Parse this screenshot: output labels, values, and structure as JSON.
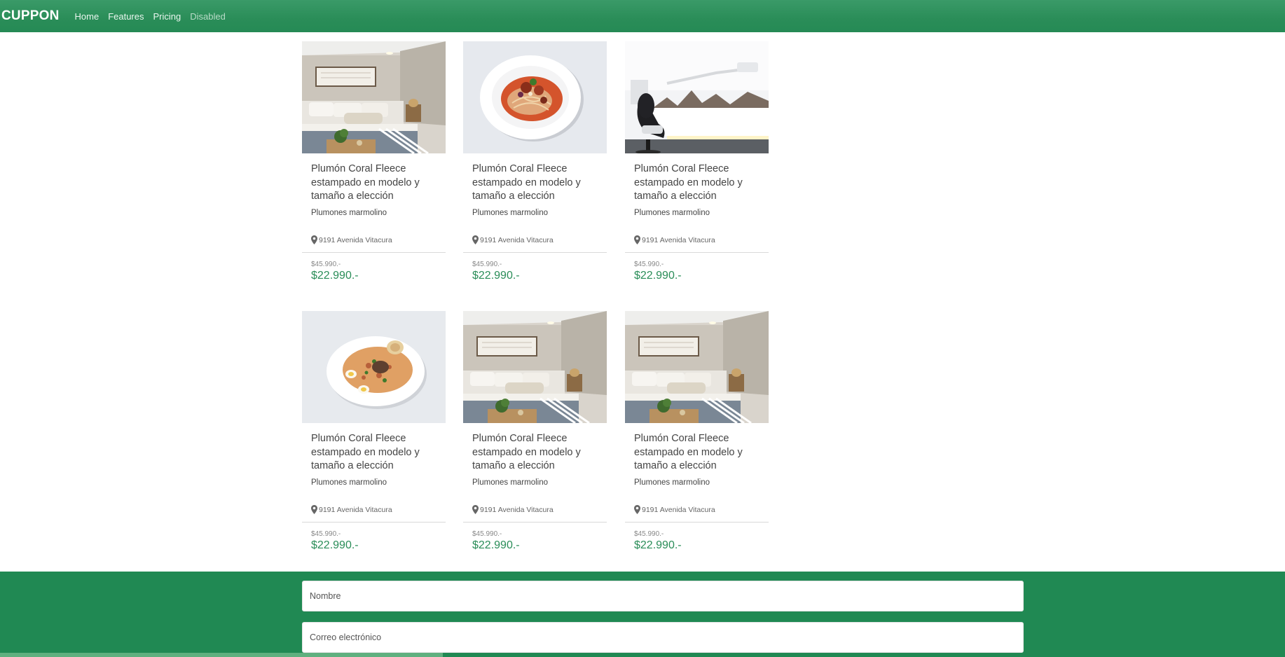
{
  "nav": {
    "brand": "CUPPON",
    "links": [
      {
        "label": "Home"
      },
      {
        "label": "Features"
      },
      {
        "label": "Pricing"
      },
      {
        "label": "Disabled"
      }
    ]
  },
  "cards": [
    {
      "image": "bedroom",
      "title": "Plumón Coral Fleece estampado en modelo y tamaño a elección",
      "category": "Plumones marmolino",
      "address": "9191 Avenida Vitacura",
      "old_price": "$45.990.-",
      "price": "$22.990.-"
    },
    {
      "image": "noodles-dish",
      "title": "Plumón Coral Fleece estampado en modelo y tamaño a elección",
      "category": "Plumones marmolino",
      "address": "9191 Avenida Vitacura",
      "old_price": "$45.990.-",
      "price": "$22.990.-"
    },
    {
      "image": "dental-office",
      "title": "Plumón Coral Fleece estampado en modelo y tamaño a elección",
      "category": "Plumones marmolino",
      "address": "9191 Avenida Vitacura",
      "old_price": "$45.990.-",
      "price": "$22.990.-"
    },
    {
      "image": "rice-dish",
      "title": "Plumón Coral Fleece estampado en modelo y tamaño a elección",
      "category": "Plumones marmolino",
      "address": "9191 Avenida Vitacura",
      "old_price": "$45.990.-",
      "price": "$22.990.-"
    },
    {
      "image": "bedroom",
      "title": "Plumón Coral Fleece estampado en modelo y tamaño a elección",
      "category": "Plumones marmolino",
      "address": "9191 Avenida Vitacura",
      "old_price": "$45.990.-",
      "price": "$22.990.-"
    },
    {
      "image": "bedroom",
      "title": "Plumón Coral Fleece estampado en modelo y tamaño a elección",
      "category": "Plumones marmolino",
      "address": "9191 Avenida Vitacura",
      "old_price": "$45.990.-",
      "price": "$22.990.-"
    }
  ],
  "form": {
    "name_placeholder": "Nombre",
    "email_placeholder": "Correo electrónico"
  },
  "colors": {
    "brand_green": "#2a8d58",
    "footer_green": "#208953"
  },
  "icons": {
    "address": "map-marker-icon"
  }
}
